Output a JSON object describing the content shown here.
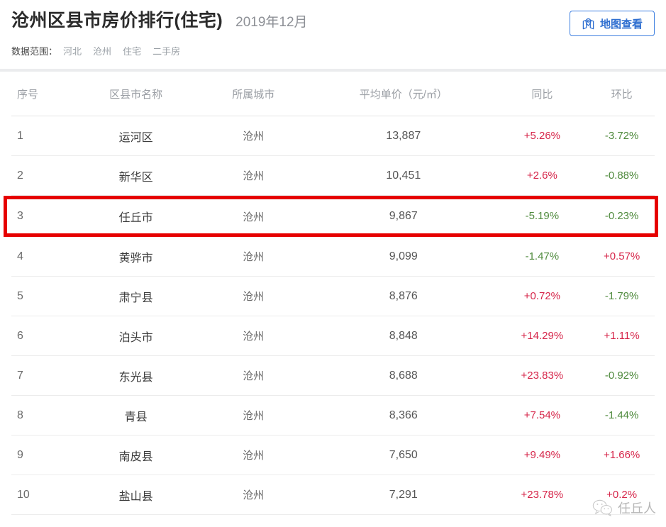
{
  "header": {
    "title": "沧州区县市房价排行(住宅)",
    "period": "2019年12月",
    "scope_label": "数据范围：",
    "scope_tags": [
      "河北",
      "沧州",
      "住宅",
      "二手房"
    ],
    "map_button_label": "地图查看",
    "map_button_icon": "map-pin-icon",
    "accent_color": "#2f6fd0"
  },
  "table": {
    "columns": [
      {
        "key": "rank",
        "label": "序号"
      },
      {
        "key": "name",
        "label": "区县市名称"
      },
      {
        "key": "city",
        "label": "所属城市"
      },
      {
        "key": "price",
        "label": "平均单价（元/㎡）"
      },
      {
        "key": "yoy",
        "label": "同比"
      },
      {
        "key": "mom",
        "label": "环比"
      }
    ],
    "highlight_color": "#e60000",
    "up_color": "#d6264a",
    "down_color": "#4f8a3d",
    "rows": [
      {
        "rank": "1",
        "name": "运河区",
        "city": "沧州",
        "price": "13,887",
        "yoy": "+5.26%",
        "yoy_dir": "up",
        "mom": "-3.72%",
        "mom_dir": "down",
        "highlighted": false
      },
      {
        "rank": "2",
        "name": "新华区",
        "city": "沧州",
        "price": "10,451",
        "yoy": "+2.6%",
        "yoy_dir": "up",
        "mom": "-0.88%",
        "mom_dir": "down",
        "highlighted": false
      },
      {
        "rank": "3",
        "name": "任丘市",
        "city": "沧州",
        "price": "9,867",
        "yoy": "-5.19%",
        "yoy_dir": "down",
        "mom": "-0.23%",
        "mom_dir": "down",
        "highlighted": true
      },
      {
        "rank": "4",
        "name": "黄骅市",
        "city": "沧州",
        "price": "9,099",
        "yoy": "-1.47%",
        "yoy_dir": "down",
        "mom": "+0.57%",
        "mom_dir": "up",
        "highlighted": false
      },
      {
        "rank": "5",
        "name": "肃宁县",
        "city": "沧州",
        "price": "8,876",
        "yoy": "+0.72%",
        "yoy_dir": "up",
        "mom": "-1.79%",
        "mom_dir": "down",
        "highlighted": false
      },
      {
        "rank": "6",
        "name": "泊头市",
        "city": "沧州",
        "price": "8,848",
        "yoy": "+14.29%",
        "yoy_dir": "up",
        "mom": "+1.11%",
        "mom_dir": "up",
        "highlighted": false
      },
      {
        "rank": "7",
        "name": "东光县",
        "city": "沧州",
        "price": "8,688",
        "yoy": "+23.83%",
        "yoy_dir": "up",
        "mom": "-0.92%",
        "mom_dir": "down",
        "highlighted": false
      },
      {
        "rank": "8",
        "name": "青县",
        "city": "沧州",
        "price": "8,366",
        "yoy": "+7.54%",
        "yoy_dir": "up",
        "mom": "-1.44%",
        "mom_dir": "down",
        "highlighted": false
      },
      {
        "rank": "9",
        "name": "南皮县",
        "city": "沧州",
        "price": "7,650",
        "yoy": "+9.49%",
        "yoy_dir": "up",
        "mom": "+1.66%",
        "mom_dir": "up",
        "highlighted": false
      },
      {
        "rank": "10",
        "name": "盐山县",
        "city": "沧州",
        "price": "7,291",
        "yoy": "+23.78%",
        "yoy_dir": "up",
        "mom": "+0.2%",
        "mom_dir": "up",
        "highlighted": false
      }
    ]
  },
  "watermark": {
    "text": "任丘人",
    "icon": "wechat-icon"
  }
}
